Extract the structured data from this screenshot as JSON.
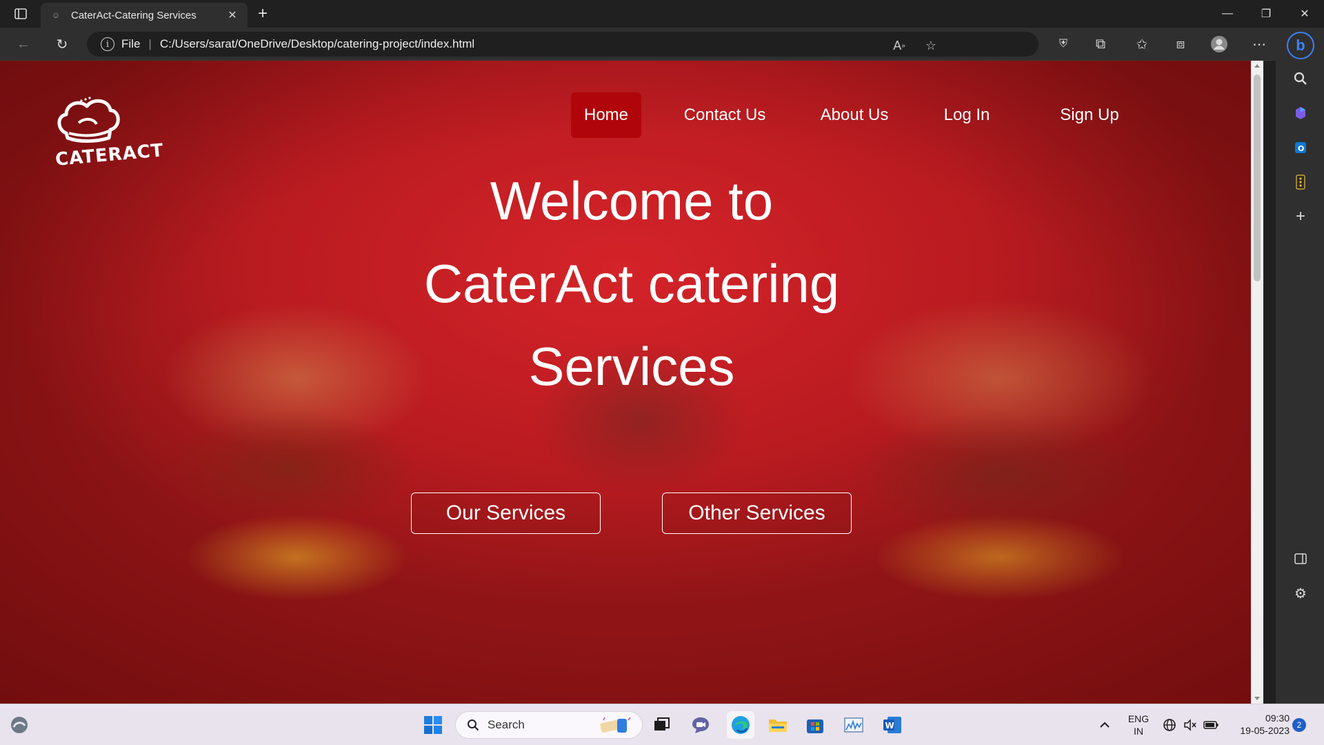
{
  "browser": {
    "tab": {
      "title": "CaterAct-Catering Services"
    },
    "address": {
      "protocol_label": "File",
      "url": "C:/Users/sarat/OneDrive/Desktop/catering-project/index.html"
    }
  },
  "page": {
    "logo_text": "CATERACT",
    "nav": [
      {
        "label": "Home",
        "active": true
      },
      {
        "label": "Contact Us",
        "active": false
      },
      {
        "label": "About Us",
        "active": false
      },
      {
        "label": "Log In",
        "active": false
      },
      {
        "label": "Sign Up",
        "active": false
      }
    ],
    "hero": {
      "line1": "Welcome to",
      "line2": "CaterAct catering",
      "line3": "Services"
    },
    "buttons": {
      "primary": "Our Services",
      "secondary": "Other Services"
    },
    "colors": {
      "accent_red": "#d42329",
      "nav_active": "#b0060b",
      "text": "#ffffff"
    }
  },
  "taskbar": {
    "search_placeholder": "Search",
    "language": {
      "line1": "ENG",
      "line2": "IN"
    },
    "time": "09:30",
    "date": "19-05-2023",
    "notification_count": "2"
  }
}
